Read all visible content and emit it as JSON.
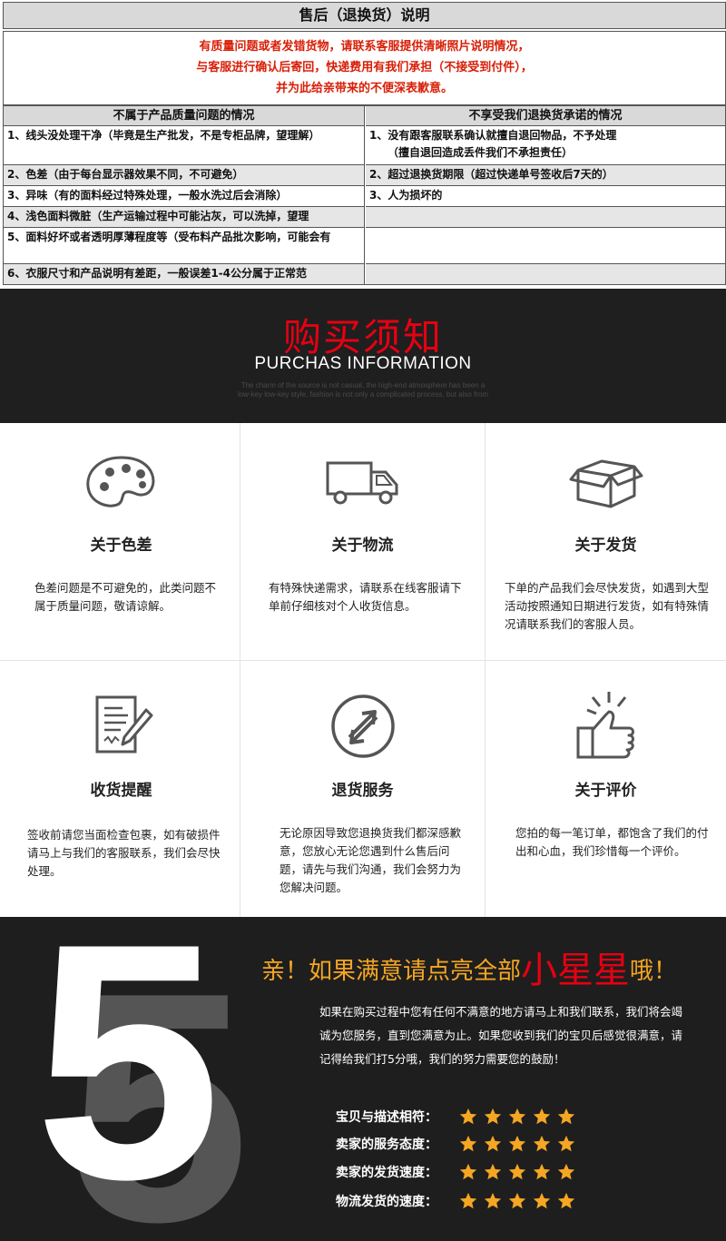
{
  "after_sales": {
    "title": "售后（退换货）说明",
    "notice": [
      "有质量问题或者发错货物，请联系客服提供清晰照片说明情况，",
      "与客服进行确认后寄回，快递费用有我们承担（不接受到付件），",
      "并为此给亲带来的不便深表歉意。"
    ],
    "left_header": "不属于产品质量问题的情况",
    "right_header": "不享受我们退换货承诺的情况",
    "left_rows": [
      "1、线头没处理干净（毕竟是生产批发，不是专柜品牌，望理解）",
      "2、色差（由于每台显示器效果不同，不可避免）",
      "3、异味（有的面料经过特殊处理，一般水洗过后会消除）",
      "4、浅色面料微脏（生产运输过程中可能沾灰，可以洗掉，望理",
      "5、面料好坏或者透明厚薄程度等（受布料产品批次影响，可能会有",
      "6、衣服尺寸和产品说明有差距，一般误差1-4公分属于正常范"
    ],
    "right_rows": [
      "1、没有跟客服联系确认就擅自退回物品，不予处理",
      "（擅自退回造成丢件我们不承担责任）",
      "2、超过退换货期限（超过快递单号签收后7天的）",
      "3、人为损坏的"
    ]
  },
  "banner": {
    "title": "购买须知",
    "subtitle": "PURCHAS INFORMATION",
    "small_text": [
      "The charm of the source is not casual, the high-end atmosphere has been a",
      "low-key low-key style, fashion is not only a complicated process, but also from"
    ]
  },
  "info_cells": [
    {
      "icon": "palette-icon",
      "title": "关于色差",
      "desc": "色差问题是不可避免的，此类问题不属于质量问题，敬请谅解。"
    },
    {
      "icon": "truck-icon",
      "title": "关于物流",
      "desc": "有特殊快递需求，请联系在线客服请下单前仔细核对个人收货信息。"
    },
    {
      "icon": "box-icon",
      "title": "关于发货",
      "desc": "下单的产品我们会尽快发货，如遇到大型活动按照通知日期进行发货，如有特殊情况请联系我们的客服人员。"
    },
    {
      "icon": "document-sign-icon",
      "title": "收货提醒",
      "desc": "签收前请您当面检查包裹，如有破损件请马上与我们的客服联系，我们会尽快处理。"
    },
    {
      "icon": "return-arrows-icon",
      "title": "退货服务",
      "desc": "无论原因导致您退换货我们都深感歉意，您放心无论您遇到什么售后问题，请先与我们沟通，我们会努力为您解决问题。"
    },
    {
      "icon": "thumbs-up-icon",
      "title": "关于评价",
      "desc": "您拍的每一笔订单，都饱含了我们的付出和心血，我们珍惜每一个评价。"
    }
  ],
  "rating": {
    "big_number": "5",
    "head_prefix": "亲！如果满意请点亮全部",
    "head_highlight": "小星星",
    "head_suffix": "哦！",
    "paragraph": "如果在购买过程中您有任何不满意的地方请马上和我们联系，我们将会竭诚为您服务，直到您满意为止。如果您收到我们的宝贝后感觉很满意，请记得给我们打5分哦，我们的努力需要您的鼓励！",
    "rows": [
      {
        "label": "宝贝与描述相符：",
        "stars": 5
      },
      {
        "label": "卖家的服务态度：",
        "stars": 5
      },
      {
        "label": "卖家的发货速度：",
        "stars": 5
      },
      {
        "label": "物流发货的速度：",
        "stars": 5
      }
    ],
    "star_color": "#f5a623"
  }
}
